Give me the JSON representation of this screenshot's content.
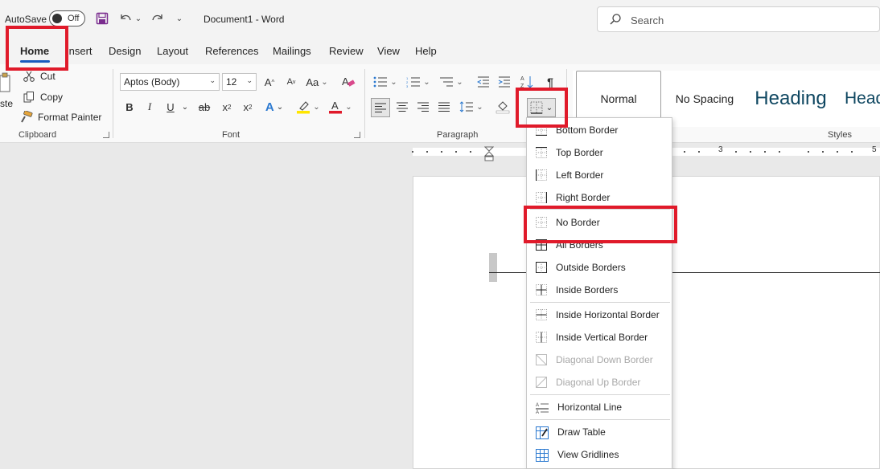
{
  "titlebar": {
    "autosave_label": "AutoSave",
    "autosave_state": "Off",
    "doc_title": "Document1  -  Word",
    "search_placeholder": "Search"
  },
  "tabs": [
    "Home",
    "Insert",
    "Design",
    "Layout",
    "References",
    "Mailings",
    "Review",
    "View",
    "Help"
  ],
  "clipboard": {
    "paste_label": "ste",
    "cut_label": "Cut",
    "copy_label": "Copy",
    "format_painter_label": "Format Painter",
    "group_label": "Clipboard"
  },
  "font": {
    "font_name": "Aptos (Body)",
    "font_size": "12",
    "bold": "B",
    "italic": "I",
    "underline": "U",
    "strike": "ab",
    "group_label": "Font"
  },
  "paragraph": {
    "group_label": "Paragraph"
  },
  "styles": {
    "normal": "Normal",
    "no_spacing": "No Spacing",
    "heading1": "Heading",
    "heading2": "Head",
    "group_label": "Styles"
  },
  "ruler": {
    "num3": "3",
    "num5": "5"
  },
  "border_menu": {
    "items": [
      {
        "label": "Bottom Border",
        "disabled": false
      },
      {
        "label": "Top Border",
        "disabled": false
      },
      {
        "label": "Left Border",
        "disabled": false
      },
      {
        "label": "Right Border",
        "disabled": false
      },
      {
        "label": "No Border",
        "disabled": false
      },
      {
        "label": "All Borders",
        "disabled": false
      },
      {
        "label": "Outside Borders",
        "disabled": false
      },
      {
        "label": "Inside Borders",
        "disabled": false
      },
      {
        "label": "Inside Horizontal Border",
        "disabled": false
      },
      {
        "label": "Inside Vertical Border",
        "disabled": false
      },
      {
        "label": "Diagonal Down Border",
        "disabled": true
      },
      {
        "label": "Diagonal Up Border",
        "disabled": true
      },
      {
        "label": "Horizontal Line",
        "disabled": false
      },
      {
        "label": "Draw Table",
        "disabled": false
      },
      {
        "label": "View Gridlines",
        "disabled": false
      }
    ]
  },
  "colors": {
    "highlight_box": "#e01a2a",
    "accent_blue": "#185abd",
    "heading_color": "#0f4761"
  }
}
